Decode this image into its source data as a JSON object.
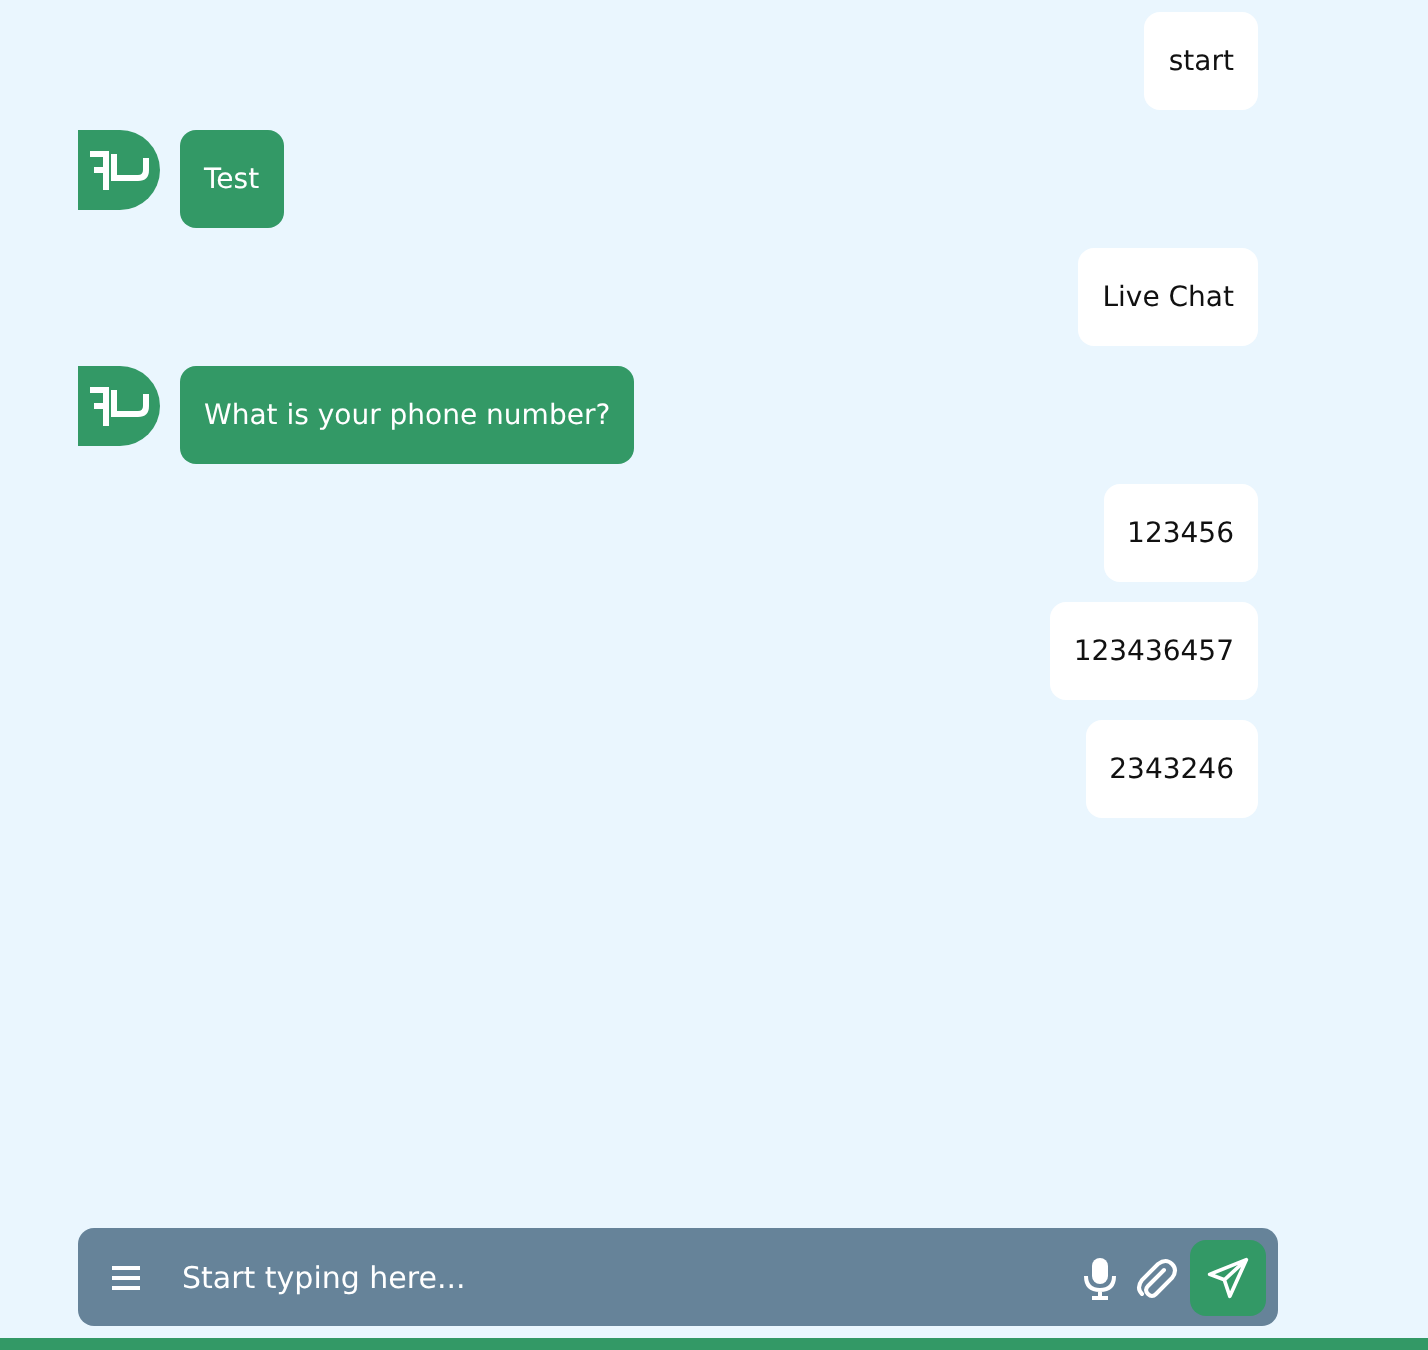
{
  "messages": [
    {
      "kind": "user",
      "text": "start"
    },
    {
      "kind": "bot",
      "text": "Test"
    },
    {
      "kind": "user",
      "text": "Live Chat"
    },
    {
      "kind": "bot",
      "text": "What is your phone number?"
    },
    {
      "kind": "user",
      "text": "123456"
    },
    {
      "kind": "user",
      "text": "123436457"
    },
    {
      "kind": "user",
      "text": "2343246"
    }
  ],
  "composer": {
    "placeholder": "Start typing here..."
  }
}
